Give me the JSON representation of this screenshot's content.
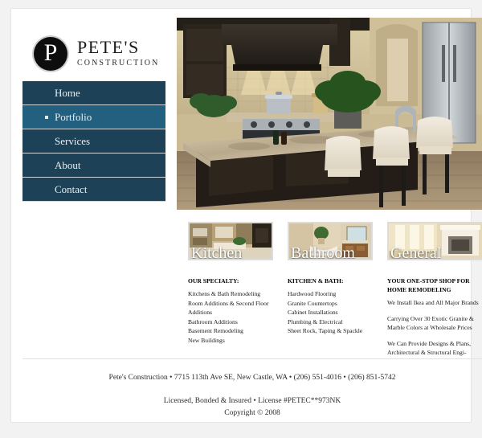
{
  "site": {
    "brand_mark_letter": "P",
    "brand_name": "PETE'S",
    "brand_sub": "CONSTRUCTION",
    "accent_color": "#1d4257",
    "accent_active_color": "#236080"
  },
  "nav": {
    "items": [
      {
        "label": "Home",
        "active": false
      },
      {
        "label": "Portfolio",
        "active": true
      },
      {
        "label": "Services",
        "active": false
      },
      {
        "label": "About",
        "active": false
      },
      {
        "label": "Contact",
        "active": false
      }
    ]
  },
  "hero": {
    "alt": "Luxury kitchen with granite island, bar stools and stainless steel range"
  },
  "cards": [
    {
      "caption": "Kitchen",
      "thumb_alt": "Kitchen remodel photo",
      "heading": "OUR SPECIALTY:",
      "lines": [
        "Kitchens & Bath Remodeling",
        "Room Additions & Second Floor",
        "Additions",
        "Bathroom Additions",
        "Basement Remodeling",
        "New Buildings"
      ]
    },
    {
      "caption": "Bathroom",
      "thumb_alt": "Bathroom remodel photo",
      "heading": "KITCHEN & BATH:",
      "lines": [
        "Hardwood Flooring",
        "Granite Countertops",
        "Cabinet Installations",
        "Plumbing & Electrical",
        "Sheet Rock, Taping & Spackle"
      ]
    },
    {
      "caption": "General",
      "thumb_alt": "General contracting fireplace photo",
      "heading": "YOUR ONE-STOP SHOP FOR HOME REMODELING",
      "paragraphs": [
        "We Install Ikea and All Major Brands",
        "Carrying Over 30 Exotic Granite & Marble Colors at Wholesale Prices",
        "We Can Provide Designs & Plans, Architectural & Structural Engi-"
      ]
    }
  ],
  "footer": {
    "line1": "Pete's Construction • 7715 113th Ave SE, New Castle, WA • (206) 551-4016 • (206) 851-5742",
    "line2": "Licensed, Bonded & Insured • License #PETEC**973NK",
    "line3": "Copyright © 2008"
  }
}
